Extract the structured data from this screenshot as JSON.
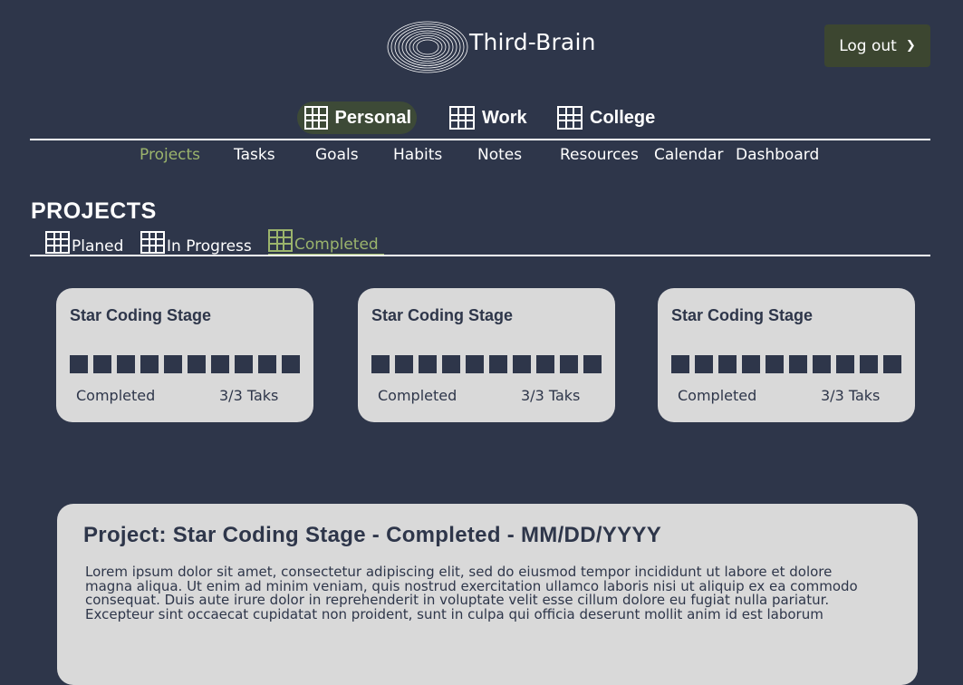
{
  "header": {
    "brand": "Third-Brain",
    "logout_label": "Log out",
    "logout_icon": "chevron-right-icon"
  },
  "workspaces": [
    {
      "label": "Personal",
      "icon": "grid-icon",
      "active": true
    },
    {
      "label": "Work",
      "icon": "grid-icon",
      "active": false
    },
    {
      "label": "College",
      "icon": "grid-icon",
      "active": false
    }
  ],
  "nav": [
    {
      "label": "Projects",
      "active": true
    },
    {
      "label": "Tasks"
    },
    {
      "label": "Goals"
    },
    {
      "label": "Habits"
    },
    {
      "label": "Notes"
    },
    {
      "label": "Resources"
    },
    {
      "label": "Calendar"
    },
    {
      "label": "Dashboard"
    }
  ],
  "section": {
    "title": "PROJECTS",
    "tabs": [
      {
        "label": "Planed",
        "active": false
      },
      {
        "label": "In Progress",
        "active": false
      },
      {
        "label": "Completed",
        "active": true
      }
    ]
  },
  "cards": [
    {
      "title": "Star Coding Stage",
      "progress": 1.0,
      "status": "Completed",
      "count": "3/3 Taks"
    },
    {
      "title": "Star Coding Stage",
      "progress": 1.0,
      "status": "Completed",
      "count": "3/3 Taks"
    },
    {
      "title": "Star Coding Stage",
      "progress": 1.0,
      "status": "Completed",
      "count": "3/3 Taks"
    }
  ],
  "detail": {
    "title": "Project: Star Coding Stage - Completed - MM/DD/YYYY",
    "body": "Lorem ipsum dolor sit amet, consectetur adipiscing elit, sed do eiusmod tempor incididunt ut labore et dolore magna aliqua. Ut enim ad minim veniam, quis nostrud exercitation ullamco laboris nisi ut aliquip ex ea commodo consequat. Duis aute irure dolor in reprehenderit in voluptate velit esse cillum dolore eu fugiat nulla pariatur. Excepteur sint occaecat cupidatat non proident, sunt in culpa qui officia deserunt mollit anim id est laborum"
  },
  "colors": {
    "background": "#2e364a",
    "accent": "#9bb46c",
    "button": "#3c4630",
    "card": "#d9d9d9"
  }
}
